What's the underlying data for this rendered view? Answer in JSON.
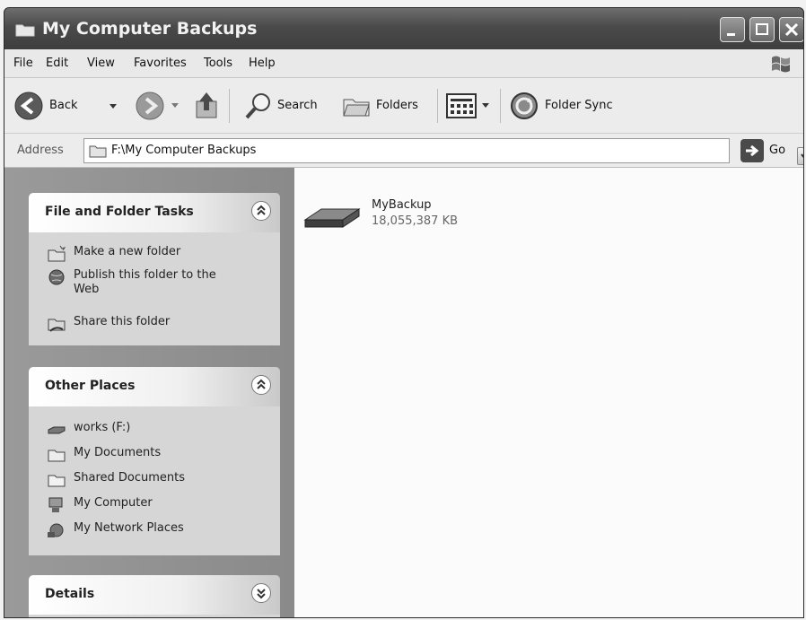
{
  "window": {
    "title": "My Computer Backups"
  },
  "menu": [
    "File",
    "Edit",
    "View",
    "Favorites",
    "Tools",
    "Help"
  ],
  "toolbar": {
    "back_label": "Back",
    "search_label": "Search",
    "folders_label": "Folders",
    "folder_sync_label": "Folder Sync"
  },
  "address": {
    "label": "Address",
    "value": "F:\\My Computer Backups",
    "go_label": "Go"
  },
  "task_pane": {
    "file_folder_tasks": {
      "title": "File and Folder Tasks",
      "items": [
        "Make a new folder",
        "Publish this folder to the Web",
        "Share this folder"
      ]
    },
    "other_places": {
      "title": "Other Places",
      "items": [
        "works (F:)",
        "My Documents",
        "Shared Documents",
        "My Computer",
        "My Network Places"
      ]
    },
    "details": {
      "title": "Details"
    }
  },
  "files": [
    {
      "name": "MyBackup",
      "size": "18,055,387 KB",
      "icon": "backup-drive-icon"
    }
  ],
  "colors": {
    "titlebar": "#4a4a4a",
    "taskpane": "#9a9a9a",
    "content": "#fbfbfb"
  }
}
